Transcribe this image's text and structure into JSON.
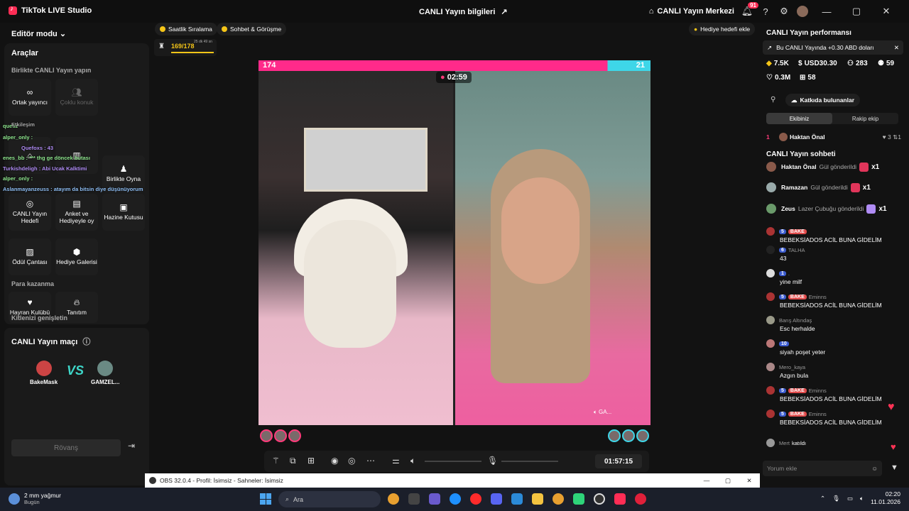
{
  "titlebar": {
    "app_name": "TikTok LIVE Studio",
    "center_title": "CANLI Yayın bilgileri",
    "live_center": "CANLI Yayın Merkezi",
    "notifications": "91"
  },
  "left": {
    "editor_mode": "Editör modu",
    "tools_title": "Araçlar",
    "together_title": "Birlikte CANLI Yayın yapın",
    "tools": {
      "co_host": "Ortak yayıncı",
      "multi_guest": "Çoklu konuk",
      "play_together": "Birlikte Oyna",
      "live_goal": "CANLI Yayın Hedefi",
      "poll": "Anket ve Hediyeyle oy",
      "treasure": "Hazine Kutusu",
      "reward_bag": "Ödül Çantası",
      "gift_gallery": "Hediye Galerisi",
      "fan_club": "Hayran Kulübü",
      "promote": "Tanıtım"
    },
    "earn_title": "Para kazanma",
    "grow_title": "Kitlenizi genişletin",
    "match_title": "CANLI Yayın maçı",
    "player_left": "BakeMask",
    "player_right": "GAMZEL...",
    "vs": "VS",
    "rematch": "Rövanş",
    "overlay": [
      {
        "text": "quesz",
        "color": "#8fe88f"
      },
      {
        "text": "Etkileşim",
        "color": "#aaaaaa"
      },
      {
        "text": "alper_only :",
        "color": "#8fe88f"
      },
      {
        "text": "Quefoxs : 43",
        "color": "#b08cf5"
      },
      {
        "text": "enes_bb : *** thg ge döncek butası",
        "color": "#8fe88f"
      },
      {
        "text": "Turkishdeligh : Abi Ucak Kalktimi",
        "color": "#b08cf5"
      },
      {
        "text": "alper_only :",
        "color": "#8fe88f"
      },
      {
        "text": "Aslanmayanzeuss : atayım da bitsin diye düşünüyorum",
        "color": "#8fbff5"
      }
    ]
  },
  "center": {
    "hourly_rank": "Saatlik Sıralama",
    "chat_meet": "Sohbet & Görüşme",
    "gift_goal": "Hediye hedefi ekle",
    "rank_value": "169/178",
    "rank_time": "25 dk 49 sn",
    "score_left": "174",
    "score_right": "21",
    "battle_timer": "02:59",
    "right_user_tag": "GA...",
    "stream_clock": "01:57:15"
  },
  "right": {
    "perf_title": "CANLI Yayın performansı",
    "promo": "Bu CANLI Yayında +0.30 ABD doları",
    "stats": {
      "diamonds": "7.5K",
      "usd": "USD30.30",
      "viewers": "283",
      "new_followers": "59",
      "likes": "0.3M",
      "gifts": "58"
    },
    "contributors": "Katkıda bulunanlar",
    "tab_ours": "Ekibiniz",
    "tab_rival": "Rakip ekip",
    "top_rank": "1",
    "top_name": "Haktan Önal",
    "top_likes": "3",
    "top_gifts": "1",
    "chat_title": "CANLI Yayın sohbeti",
    "gifts": [
      {
        "name": "Haktan Önal",
        "msg": "Gül gönderildi",
        "count": "x1"
      },
      {
        "name": "Ramazan",
        "msg": "Gül gönderildi",
        "count": "x1"
      },
      {
        "name": "Zeus",
        "msg": "Lazer Çubuğu gönderildi",
        "count": "x1"
      }
    ],
    "chat": [
      {
        "user": "",
        "level": "5",
        "fan": "BAKE",
        "body": "BEBEKSİADOS ACİL BUNA GİDELİM"
      },
      {
        "user": "TALHA",
        "level": "6",
        "fan": "",
        "body": "43"
      },
      {
        "user": ".",
        "level": "1",
        "fan": "",
        "body": "yine milf"
      },
      {
        "user": "Eminns",
        "level": "5",
        "fan": "BAKE",
        "body": "BEBEKSİADOS ACİL BUNA GİDELİM"
      },
      {
        "user": "Barış Altındaş",
        "level": "",
        "fan": "",
        "body": "Esc herhalde"
      },
      {
        "user": "",
        "level": "10",
        "fan": "",
        "body": "siyah poşet yeter"
      },
      {
        "user": "Mero_kaya",
        "level": "",
        "fan": "",
        "body": "Azgın bula"
      },
      {
        "user": "Eminns",
        "level": "5",
        "fan": "BAKE",
        "body": "BEBEKSİADOS ACİL BUNA GİDELİM"
      },
      {
        "user": "Eminns",
        "level": "5",
        "fan": "BAKE",
        "body": "BEBEKSİADOS ACİL BUNA GİDELİM"
      }
    ],
    "join_user": "Mert",
    "join_msg": "katıldı",
    "comment_placeholder": "Yorum ekle"
  },
  "obs": {
    "title": "OBS 32.0.4 - Profil: İsimsiz - Sahneler: İsimsiz"
  },
  "taskbar": {
    "weather": "2 mm yağmur",
    "weather_sub": "Bugün",
    "search": "Ara",
    "time": "02:20",
    "date": "11.01.2026"
  }
}
